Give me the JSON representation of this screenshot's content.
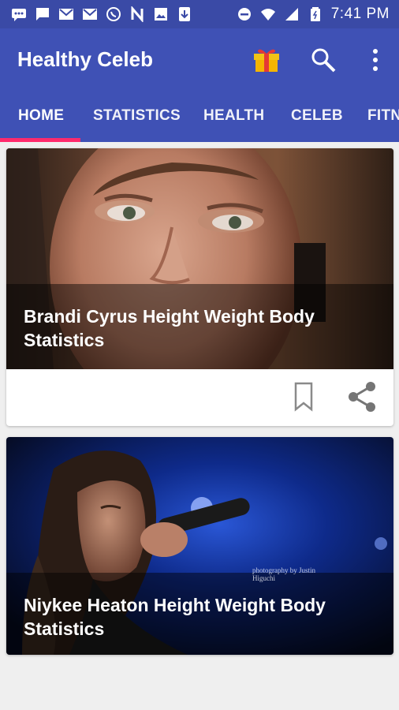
{
  "status_bar": {
    "time": "7:41 PM",
    "left_icons": [
      "messages-icon",
      "chat-icon",
      "gmail-icon",
      "gmail-icon",
      "whatsapp-icon",
      "n-app-icon",
      "gallery-icon",
      "download-icon"
    ],
    "right_icons": [
      "dnd-icon",
      "wifi-icon",
      "signal-icon",
      "battery-icon"
    ]
  },
  "app_bar": {
    "title": "Healthy Celeb",
    "gift_color": "#f2c316",
    "icons": [
      "gift-icon",
      "search-icon",
      "more-vert-icon"
    ]
  },
  "tabs": [
    {
      "label": "HOME",
      "active": true
    },
    {
      "label": "STATISTICS",
      "active": false
    },
    {
      "label": "HEALTH",
      "active": false
    },
    {
      "label": "CELEB",
      "active": false
    },
    {
      "label": "FITN",
      "active": false
    }
  ],
  "colors": {
    "primary": "#3f51b5",
    "status_bar": "#3a4aa6",
    "accent": "#ff2a6d"
  },
  "articles": [
    {
      "title": "Brandi Cyrus Height Weight Body Statistics",
      "bookmark_icon": "bookmark-icon",
      "share_icon": "share-icon"
    },
    {
      "title": "Niykee Heaton Height Weight Body Statistics",
      "watermark": "photography by Justin Higuchi"
    }
  ]
}
